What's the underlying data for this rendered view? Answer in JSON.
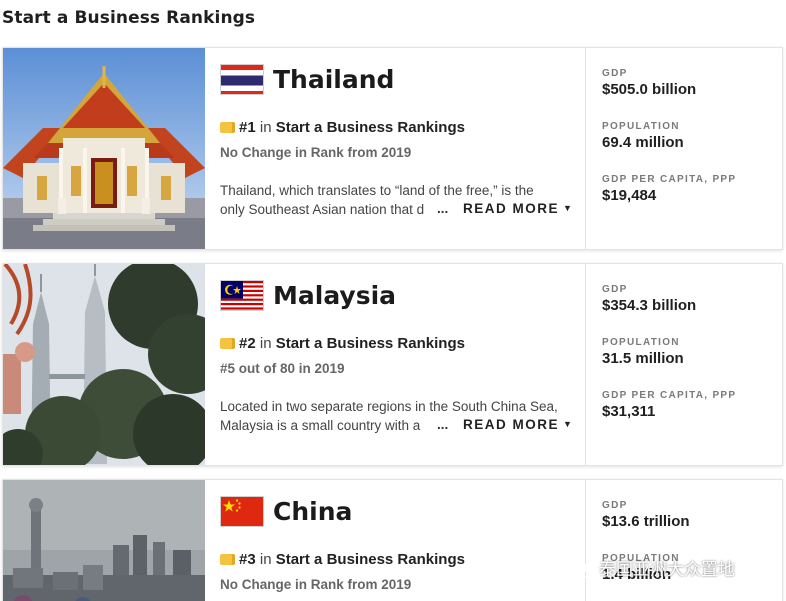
{
  "page": {
    "title": "Start a Business Rankings"
  },
  "colors": {
    "ribbon": "#f5c242",
    "card_border": "#e4e4e4",
    "label_gray": "#7a7a7a"
  },
  "cards": [
    {
      "country": "Thailand",
      "flag_icon": "thailand-flag-icon",
      "photo_icon": "thai-temple-photo",
      "rank_number": "#1",
      "rank_in": "in",
      "rank_list": "Start a Business Rankings",
      "rank_change": "No Change in Rank from 2019",
      "desc_line1": "Thailand, which translates to “land of the free,” is the",
      "desc_line2": "only Southeast Asian nation that d",
      "ellipsis": "...",
      "read_more": "READ MORE",
      "stats": [
        {
          "label": "GDP",
          "value": "$505.0 billion"
        },
        {
          "label": "POPULATION",
          "value": "69.4 million"
        },
        {
          "label": "GDP PER CAPITA, PPP",
          "value": "$19,484"
        }
      ]
    },
    {
      "country": "Malaysia",
      "flag_icon": "malaysia-flag-icon",
      "photo_icon": "petronas-towers-photo",
      "rank_number": "#2",
      "rank_in": "in",
      "rank_list": "Start a Business Rankings",
      "rank_change": "#5 out of 80 in 2019",
      "desc_line1": "Located in two separate regions in the South China Sea,",
      "desc_line2": "Malaysia is a small country with a",
      "ellipsis": "...",
      "read_more": "READ MORE",
      "stats": [
        {
          "label": "GDP",
          "value": "$354.3 billion"
        },
        {
          "label": "POPULATION",
          "value": "31.5 million"
        },
        {
          "label": "GDP PER CAPITA, PPP",
          "value": "$31,311"
        }
      ]
    },
    {
      "country": "China",
      "flag_icon": "china-flag-icon",
      "photo_icon": "shanghai-skyline-photo",
      "rank_number": "#3",
      "rank_in": "in",
      "rank_list": "Start a Business Rankings",
      "rank_change": "No Change in Rank from 2019",
      "stats": [
        {
          "label": "GDP",
          "value": "$13.6 trillion"
        },
        {
          "label": "POPULATION",
          "value": "1.4 billion"
        }
      ]
    }
  ],
  "watermark": {
    "text": "泰国亚洲大众置地",
    "icon": "wechat-icon"
  }
}
